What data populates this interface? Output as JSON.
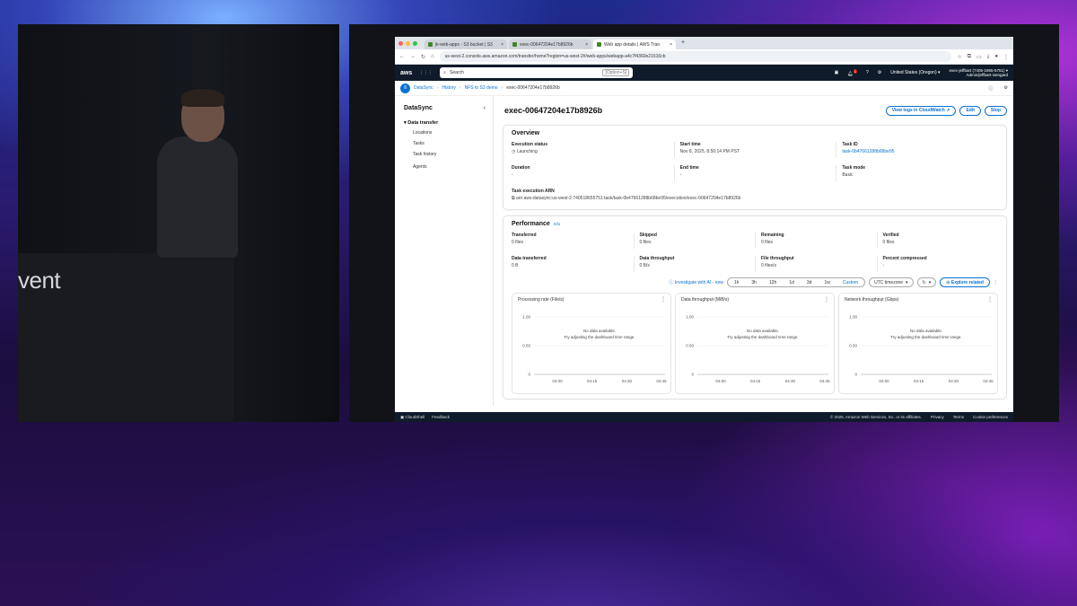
{
  "stage": {
    "event_text": "vent"
  },
  "browser": {
    "tabs": [
      {
        "title": "jk-web-apps - S3 bucket | S3"
      },
      {
        "title": "exec-00647204e17b8926b"
      },
      {
        "title": "Web app details | AWS Tran"
      }
    ],
    "url": "us-west-2.console.aws.amazon.com/transfer/home?region=us-west-2#/web-apps/webapp-a4c7f4360e21616cb"
  },
  "aws_nav": {
    "logo": "aws",
    "search_placeholder": "Search",
    "search_shortcut": "[Option+S]",
    "region": "United States (Oregon) ▾",
    "account_line1": "exec-jeffbart (7405-1865-5751) ▾",
    "account_line2": "Admin/jeffbart-isengard",
    "notification_count": "1"
  },
  "breadcrumb": [
    "DataSync",
    "History",
    "NFS to S3 demo",
    "exec-00647204e17b8926b"
  ],
  "sidebar": {
    "title": "DataSync",
    "group": "Data transfer",
    "items": [
      "Locations",
      "Tasks",
      "Task history"
    ],
    "agents": "Agents"
  },
  "page": {
    "title": "exec-00647204e17b8926b",
    "btn_view_logs": "View logs in CloudWatch ↗",
    "btn_edit": "Edit",
    "btn_stop": "Stop"
  },
  "overview": {
    "title": "Overview",
    "exec_status_label": "Execution status",
    "exec_status_value": "Launching",
    "start_time_label": "Start time",
    "start_time_value": "Nov 8, 2025, 8:50:14 PM PST",
    "task_id_label": "Task ID",
    "task_id_value": "task-0b47661288b68be95",
    "duration_label": "Duration",
    "duration_value": "-",
    "end_time_label": "End time",
    "end_time_value": "-",
    "task_mode_label": "Task mode",
    "task_mode_value": "Basic",
    "arn_label": "Task execution ARN",
    "arn_value": "arn:aws:datasync:us-west-2:740518655751:task/task-0b47661288b68be95/execution/exec-00647204e17b8926b"
  },
  "performance": {
    "title": "Performance",
    "info": "Info",
    "metrics": [
      {
        "label": "Transferred",
        "value": "0 files"
      },
      {
        "label": "Skipped",
        "value": "0 files"
      },
      {
        "label": "Remaining",
        "value": "0 files"
      },
      {
        "label": "Verified",
        "value": "0 files"
      },
      {
        "label": "Data transferred",
        "value": "0 B"
      },
      {
        "label": "Data throughput",
        "value": "0 B/s"
      },
      {
        "label": "File throughput",
        "value": "0 files/s"
      },
      {
        "label": "Percent compressed",
        "value": "-"
      }
    ],
    "investigate": "Investigate with AI - new",
    "ranges": [
      "1h",
      "3h",
      "12h",
      "1d",
      "3d",
      "1w",
      "Custom"
    ],
    "timezone": "UTC timezone",
    "explore": "Explore related"
  },
  "chart_data": [
    {
      "type": "line",
      "title": "Processing rate (File/s)",
      "ylim": [
        0,
        1
      ],
      "y_ticks": [
        "1.00",
        "0.50",
        "0"
      ],
      "x_ticks": [
        "04:00",
        "04:15",
        "04:30",
        "04:45"
      ],
      "series": [],
      "empty_title": "No data available.",
      "empty_sub": "Try adjusting the dashboard time range."
    },
    {
      "type": "line",
      "title": "Data throughput (MiB/s)",
      "ylim": [
        0,
        1
      ],
      "y_ticks": [
        "1.00",
        "0.50",
        "0"
      ],
      "x_ticks": [
        "04:00",
        "04:15",
        "04:30",
        "04:45"
      ],
      "series": [],
      "empty_title": "No data available.",
      "empty_sub": "Try adjusting the dashboard time range."
    },
    {
      "type": "line",
      "title": "Network throughput (Gbps)",
      "ylim": [
        0,
        1
      ],
      "y_ticks": [
        "1.00",
        "0.50",
        "0"
      ],
      "x_ticks": [
        "04:00",
        "04:15",
        "04:30",
        "04:45"
      ],
      "series": [],
      "empty_title": "No data available.",
      "empty_sub": "Try adjusting the dashboard time range."
    }
  ],
  "footer": {
    "cloudshell": "CloudShell",
    "feedback": "Feedback",
    "copyright": "© 2025, Amazon Web Services, Inc. or its affiliates.",
    "privacy": "Privacy",
    "terms": "Terms",
    "cookies": "Cookie preferences"
  }
}
